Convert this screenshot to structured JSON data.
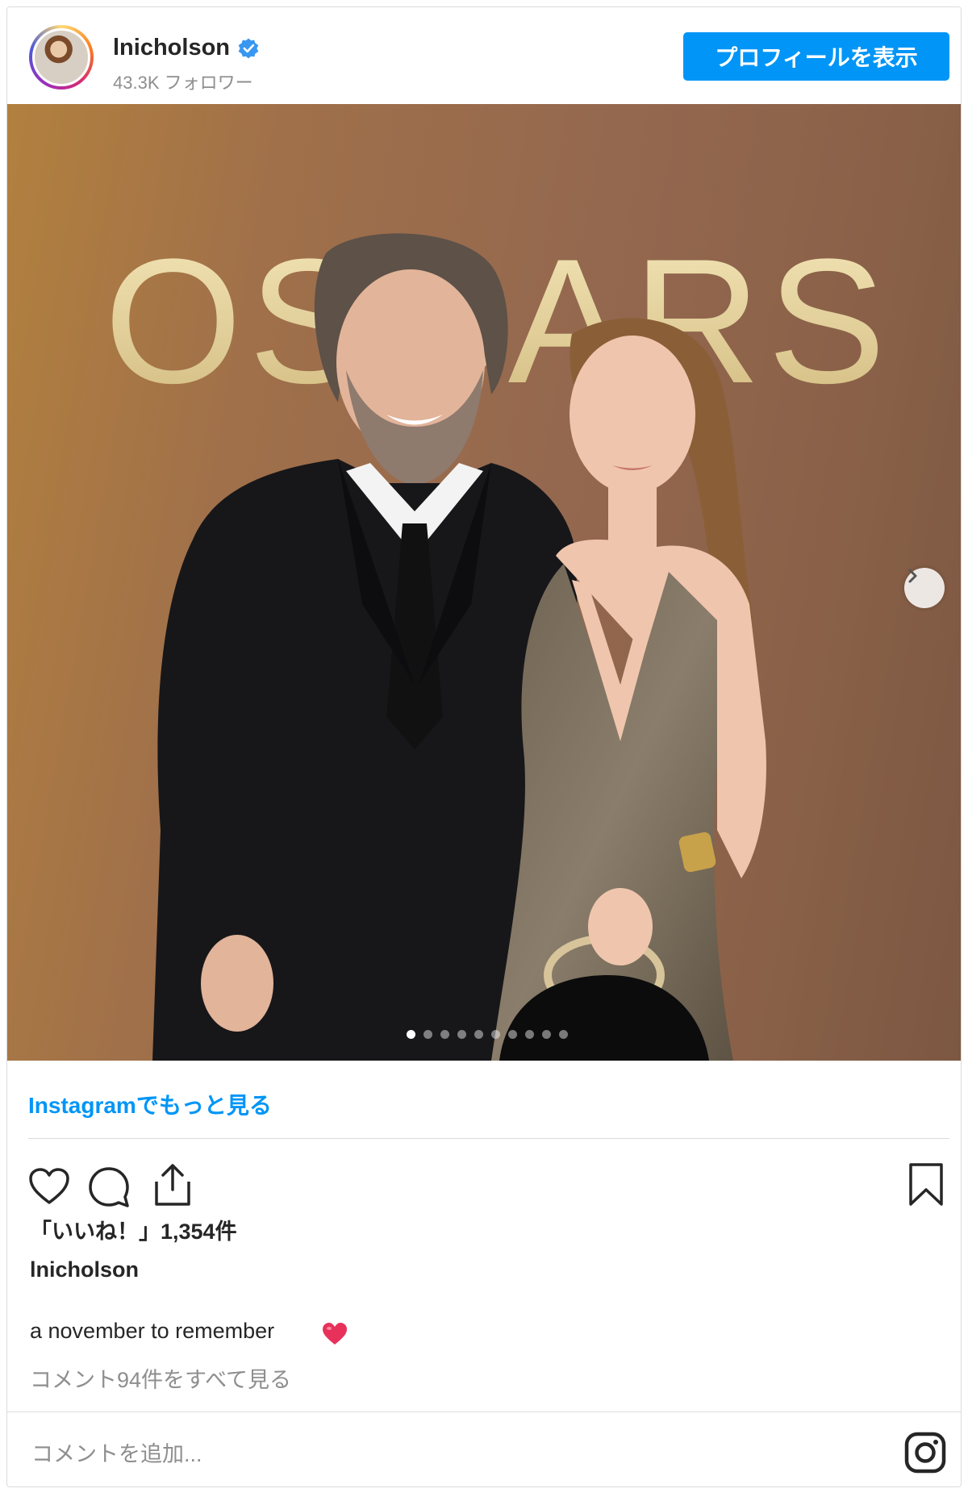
{
  "header": {
    "username": "lnicholson",
    "followers": "43.3K フォロワー",
    "profile_button": "プロフィールを表示"
  },
  "photo": {
    "backdrop_text": "OSCARS",
    "carousel": {
      "total": 10,
      "active_index": 0
    }
  },
  "footer": {
    "more_link": "Instagramでもっと見る",
    "likes": "「いいね！」1,354件",
    "caption_user": "lnicholson",
    "caption_text": "a november to remember",
    "comments_link": "コメント94件をすべて見る",
    "comment_placeholder": "コメントを追加..."
  },
  "icons": {
    "like": "heart-icon",
    "comment": "comment-icon",
    "share": "share-icon",
    "save": "bookmark-icon",
    "next": "chevron-right-icon",
    "brand": "instagram-icon",
    "verified": "verified-badge-icon",
    "caption_emoji": "heart-emoji"
  },
  "colors": {
    "accent": "#0095f6",
    "secondary_text": "#8e8e8e",
    "emoji": "#e8315a"
  }
}
